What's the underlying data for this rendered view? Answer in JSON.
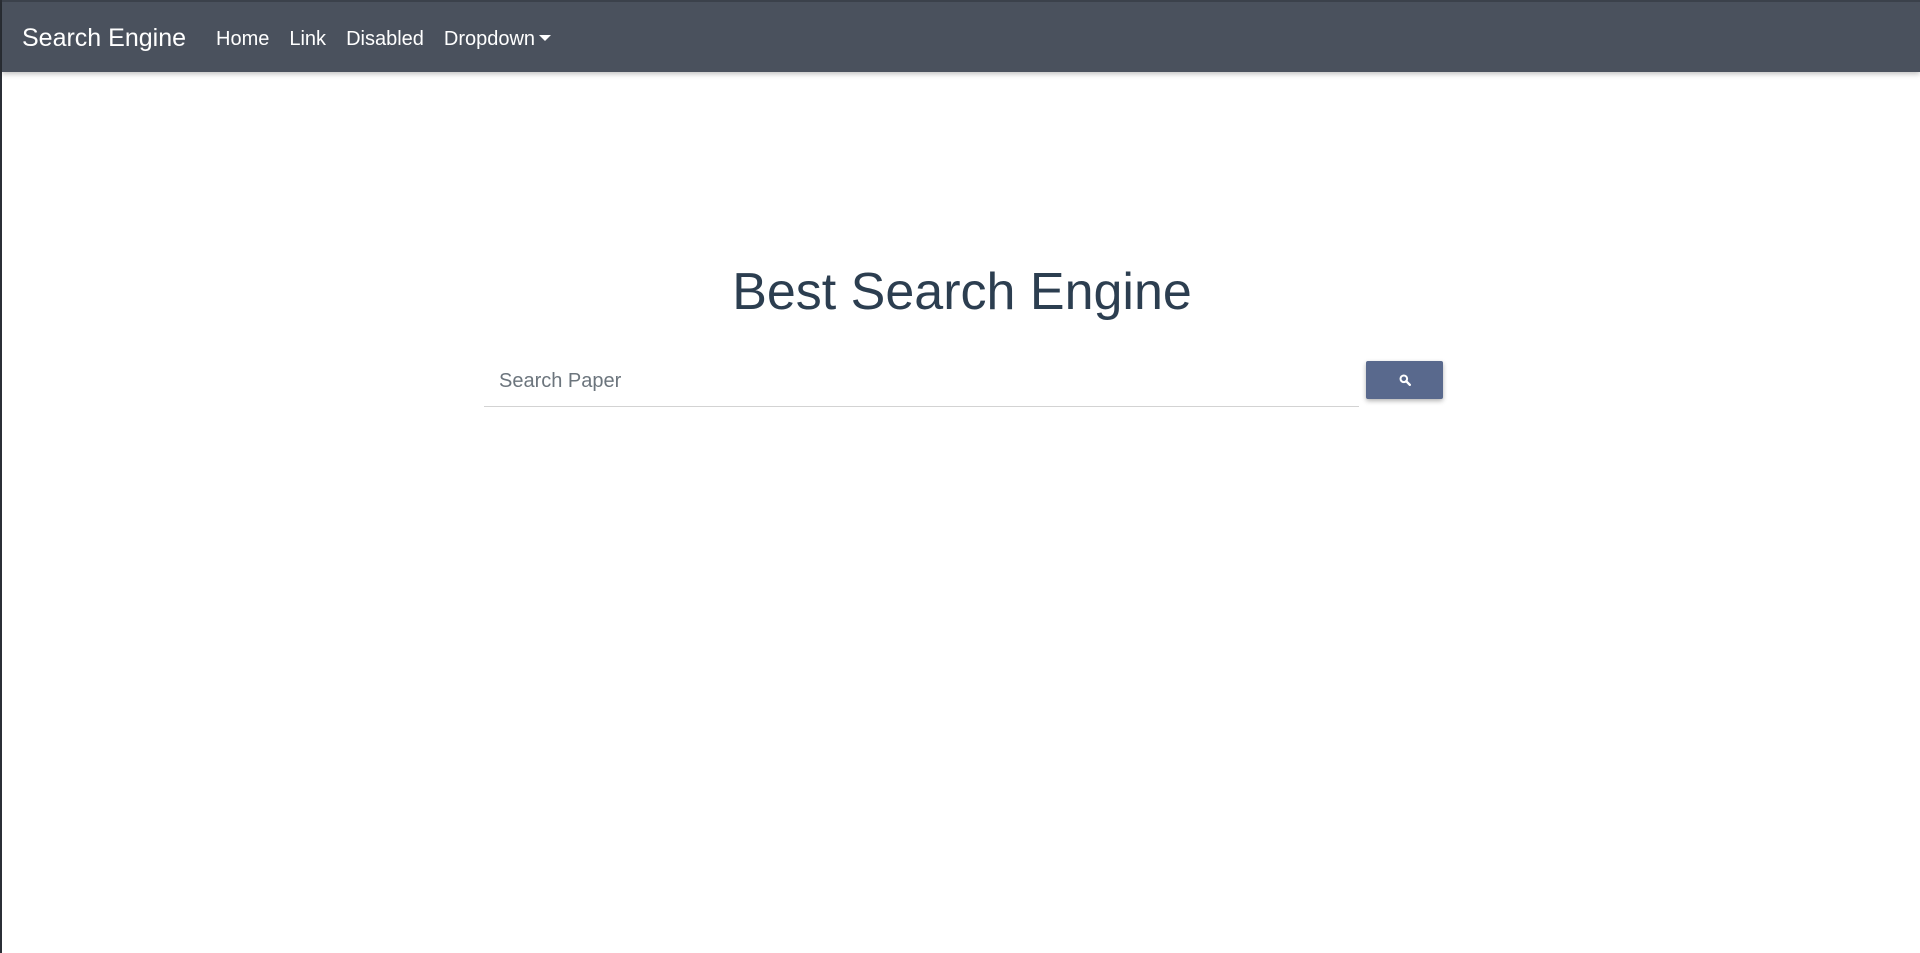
{
  "navbar": {
    "brand": "Search Engine",
    "links": [
      {
        "label": "Home"
      },
      {
        "label": "Link"
      },
      {
        "label": "Disabled"
      },
      {
        "label": "Dropdown"
      }
    ]
  },
  "main": {
    "heading": "Best Search Engine",
    "search": {
      "placeholder": "Search Paper",
      "value": "",
      "button_icon": "search-icon"
    }
  },
  "colors": {
    "navbar_bg": "#4a515d",
    "heading_text": "#2c3e50",
    "button_bg": "#59698d"
  }
}
